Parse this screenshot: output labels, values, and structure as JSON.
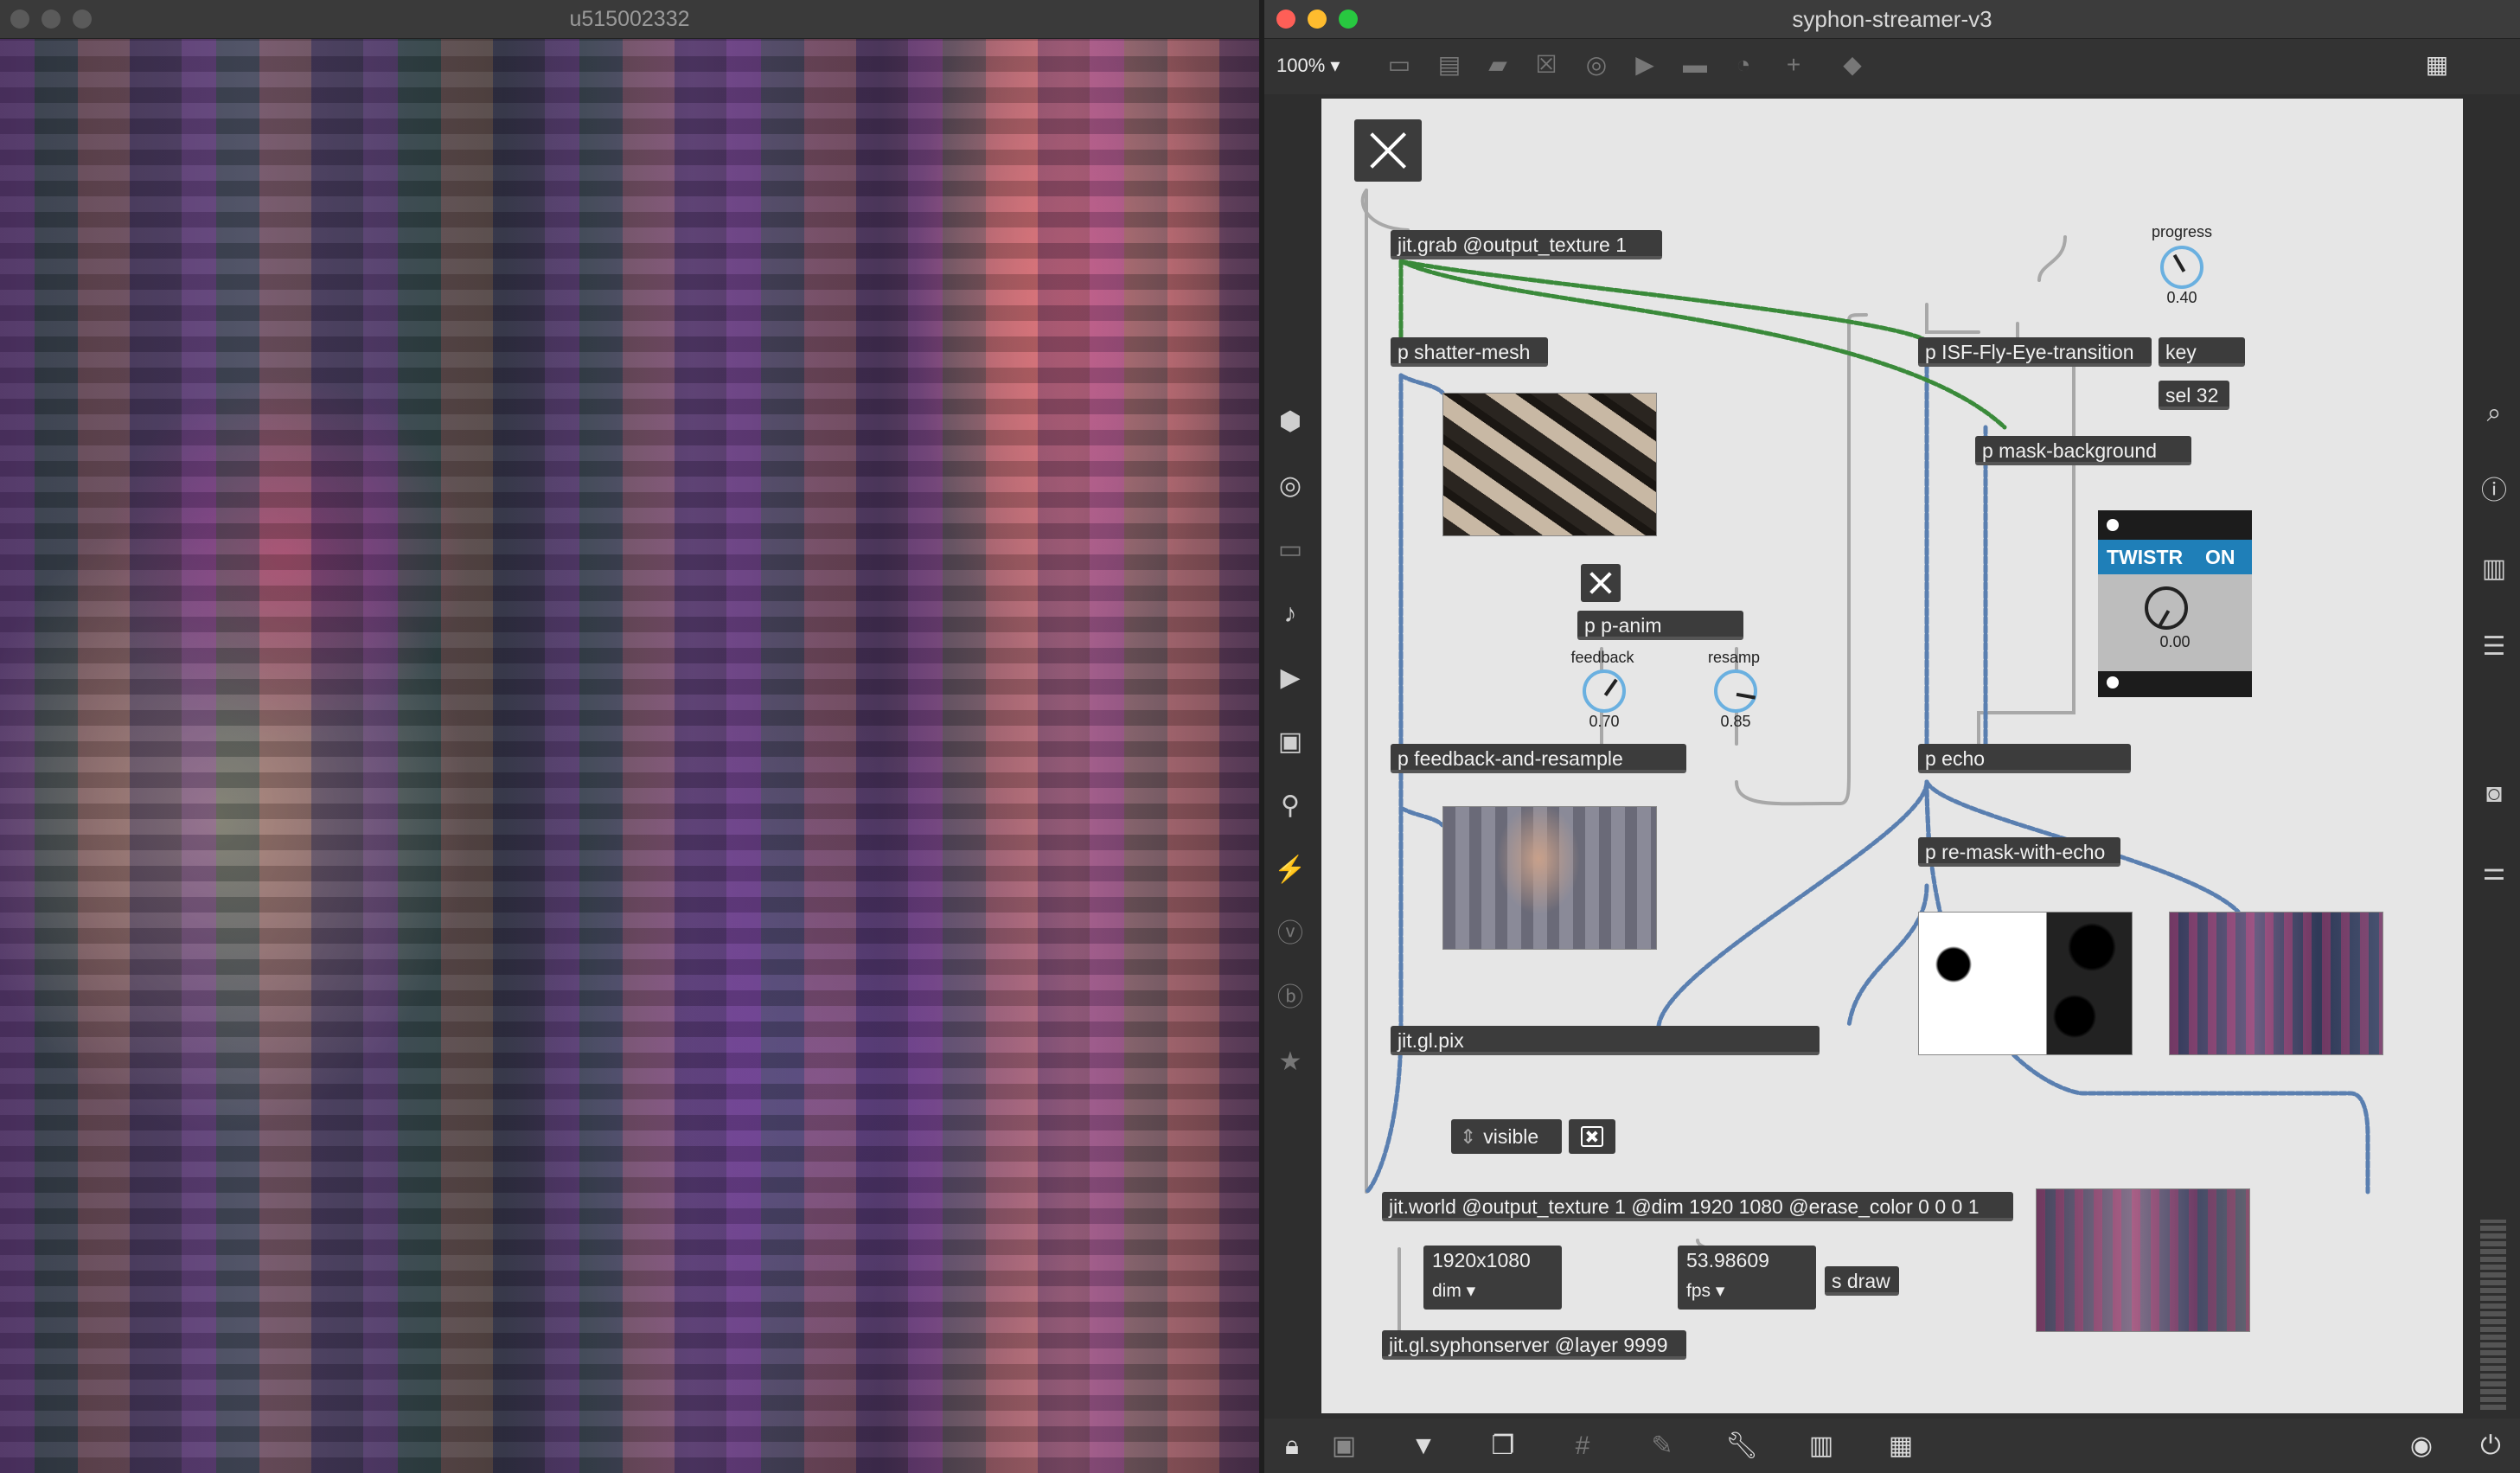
{
  "video_window": {
    "title": "u515002332"
  },
  "patcher_window": {
    "title": "syphon-streamer-v3",
    "zoom": "100% ▾"
  },
  "objects": {
    "grab": "jit.grab @output_texture 1",
    "shatter": "p shatter-mesh",
    "isf": "p ISF-Fly-Eye-transition",
    "key": "key",
    "sel": "sel 32",
    "mask_bg": "p mask-background",
    "panim": "p p-anim",
    "feedback_resample": "p feedback-and-resample",
    "echo": "p echo",
    "remask": "p re-mask-with-echo",
    "glpix": "jit.gl.pix",
    "world": "jit.world @output_texture 1 @dim 1920 1080 @erase_color 0 0 0 1",
    "draw": "s draw",
    "syphon": "jit.gl.syphonserver @layer 9999"
  },
  "dials": {
    "progress": {
      "label": "progress",
      "value": "0.40"
    },
    "feedback": {
      "label": "feedback",
      "value": "0.70"
    },
    "resamp": {
      "label": "resamp",
      "value": "0.85"
    },
    "twistr": {
      "value": "0.00"
    }
  },
  "twistr": {
    "name": "TWISTR",
    "state": "ON"
  },
  "visible_toggle": {
    "label": "visible"
  },
  "dim_menu": {
    "value": "1920x1080",
    "label": "dim ▾"
  },
  "fps_menu": {
    "value": "53.98609",
    "label": "fps ▾"
  },
  "colors": {
    "canvas": "#e6e6e6",
    "object": "#3c3c3c",
    "dial": "#6ab0e0",
    "twistr_blue": "#1f7fb8"
  }
}
